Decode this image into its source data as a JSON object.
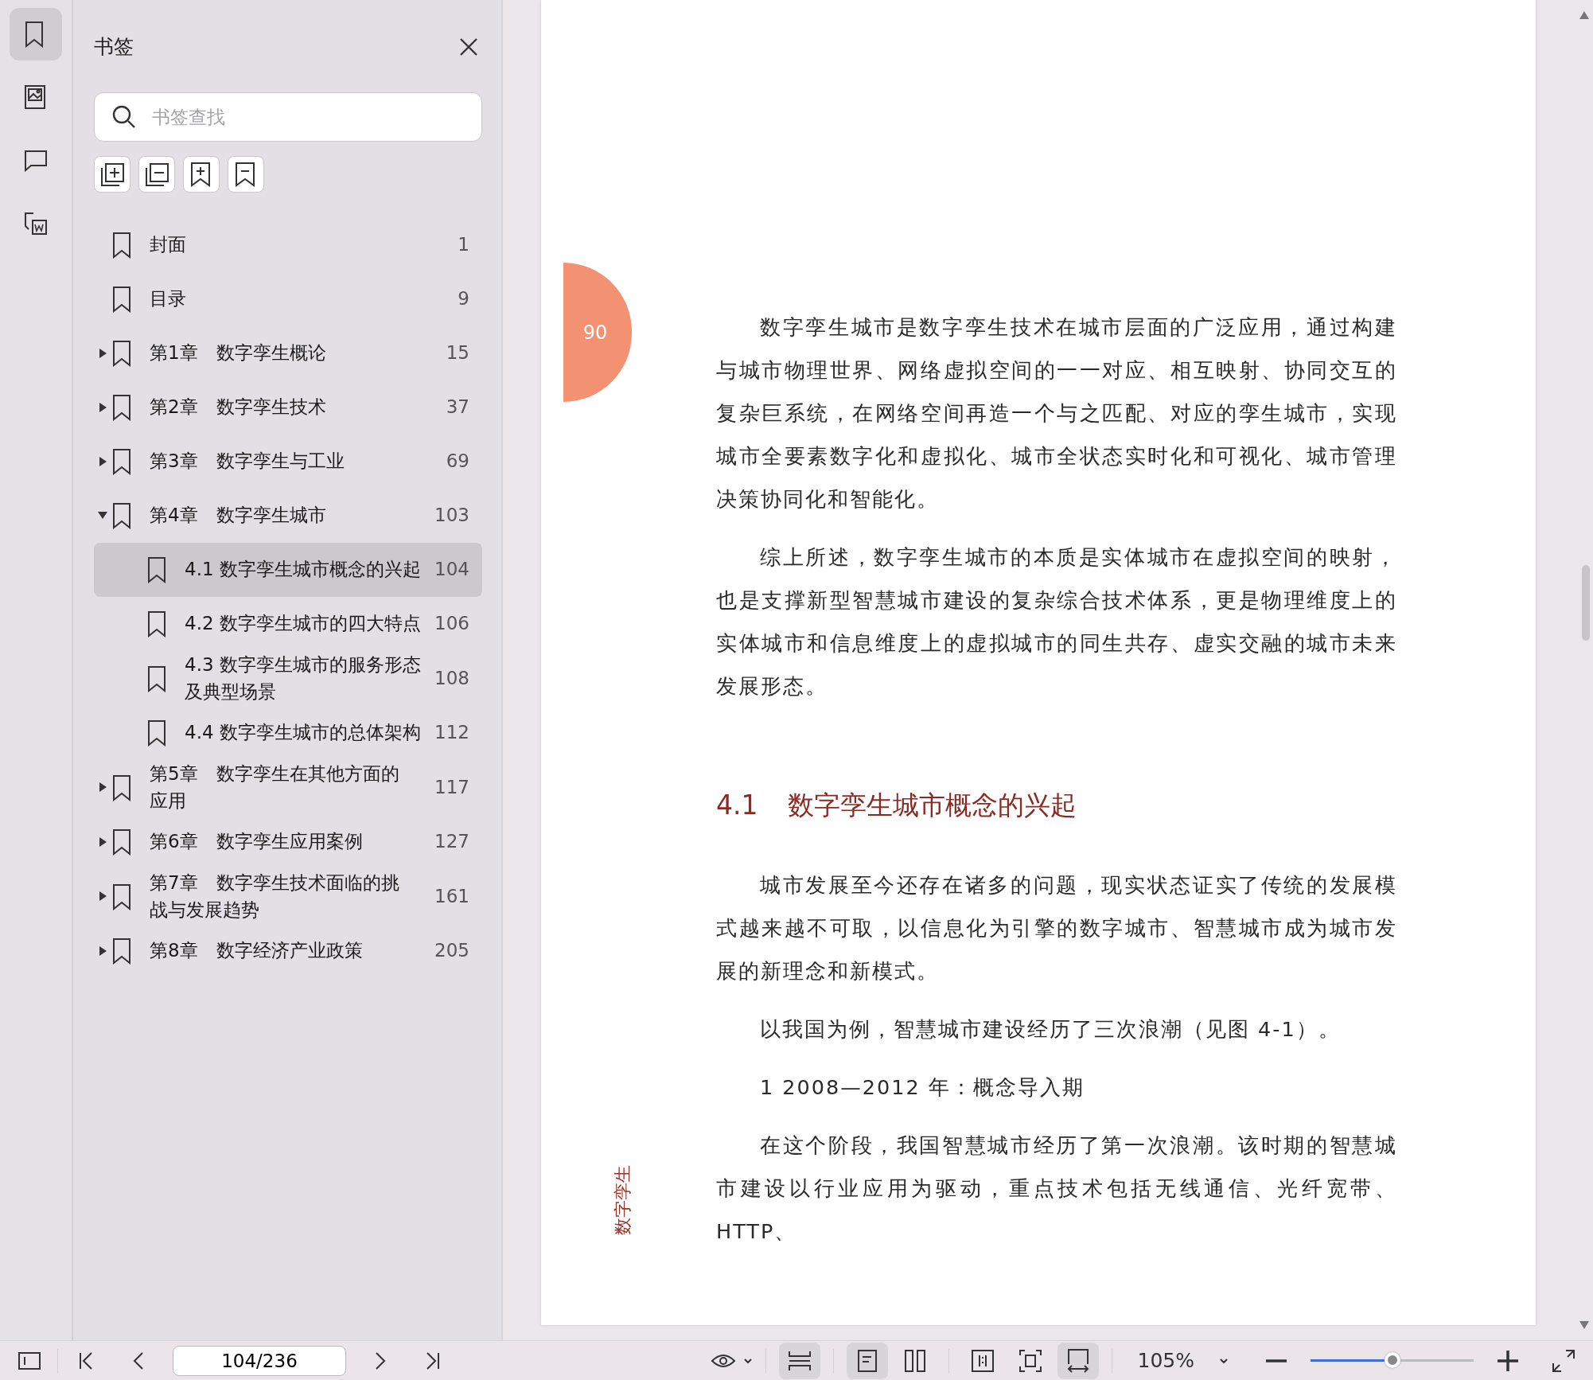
{
  "rail": [
    {
      "kind": "bookmark",
      "selected": true
    },
    {
      "kind": "image",
      "selected": false
    },
    {
      "kind": "comment",
      "selected": false
    },
    {
      "kind": "convert",
      "selected": false
    }
  ],
  "sidebar": {
    "title": "书签",
    "search": {
      "placeholder": "书签查找"
    },
    "items": [
      {
        "label": "封面",
        "page": "1",
        "selected": false
      },
      {
        "label": "目录",
        "page": "9",
        "selected": false
      },
      {
        "label": "第1章　数字孪生概论",
        "page": "15",
        "expanded": false,
        "selected": false
      },
      {
        "label": "第2章　数字孪生技术",
        "page": "37",
        "expanded": false,
        "selected": false
      },
      {
        "label": "第3章　数字孪生与工业",
        "page": "69",
        "expanded": false,
        "selected": false
      },
      {
        "label": "第4章　数字孪生城市",
        "page": "103",
        "expanded": true,
        "selected": false,
        "children": [
          {
            "label": "4.1 数字孪生城市概念的兴起",
            "page": "104",
            "selected": true
          },
          {
            "label": "4.2 数字孪生城市的四大特点",
            "page": "106",
            "selected": false
          },
          {
            "label": "4.3 数字孪生城市的服务形态及典型场景",
            "page": "108",
            "selected": false
          },
          {
            "label": "4.4 数字孪生城市的总体架构",
            "page": "112",
            "selected": false
          }
        ]
      },
      {
        "label": "第5章　数字孪生在其他方面的应用",
        "page": "117",
        "expanded": false,
        "selected": false
      },
      {
        "label": "第6章　数字孪生应用案例",
        "page": "127",
        "expanded": false,
        "selected": false
      },
      {
        "label": "第7章　数字孪生技术面临的挑战与发展趋势",
        "page": "161",
        "expanded": false,
        "selected": false
      },
      {
        "label": "第8章　数字经济产业政策",
        "page": "205",
        "expanded": false,
        "selected": false
      }
    ]
  },
  "page": {
    "page_tab": "90",
    "side_title": "数字孪生",
    "blocks": [
      {
        "kind": "para",
        "text": "数字孪生城市是数字孪生技术在城市层面的广泛应用，通过构建与城市物理世界、网络虚拟空间的一一对应、相互映射、协同交互的复杂巨系统，在网络空间再造一个与之匹配、对应的孪生城市，实现城市全要素数字化和虚拟化、城市全状态实时化和可视化、城市管理决策协同化和智能化。"
      },
      {
        "kind": "para",
        "text": "综上所述，数字孪生城市的本质是实体城市在虚拟空间的映射，也是支撑新型智慧城市建设的复杂综合技术体系，更是物理维度上的实体城市和信息维度上的虚拟城市的同生共存、虚实交融的城市未来发展形态。"
      },
      {
        "kind": "heading",
        "number": "4.1",
        "text": "数字孪生城市概念的兴起"
      },
      {
        "kind": "para",
        "text": "城市发展至今还存在诸多的问题，现实状态证实了传统的发展模式越来越不可取，以信息化为引擎的数字城市、智慧城市成为城市发展的新理念和新模式。"
      },
      {
        "kind": "para",
        "text": "以我国为例，智慧城市建设经历了三次浪潮（见图 4-1）。"
      },
      {
        "kind": "para",
        "text": "1  2008—2012 年：概念导入期"
      },
      {
        "kind": "para",
        "text": "在这个阶段，我国智慧城市经历了第一次浪潮。该时期的智慧城市建设以行业应用为驱动，重点技术包括无线通信、光纤宽带、HTTP、"
      }
    ]
  },
  "toolbar": {
    "page_field": "104/236",
    "zoom": "105%",
    "zoom_slider": {
      "level": 0.5
    },
    "views": [
      {
        "kind": "continuous",
        "selected": true
      },
      {
        "kind": "single",
        "selected": true
      },
      {
        "kind": "double",
        "selected": false
      },
      {
        "kind": "book",
        "selected": false
      },
      {
        "kind": "fit",
        "selected": false
      },
      {
        "kind": "fit-width",
        "selected": true
      }
    ]
  }
}
